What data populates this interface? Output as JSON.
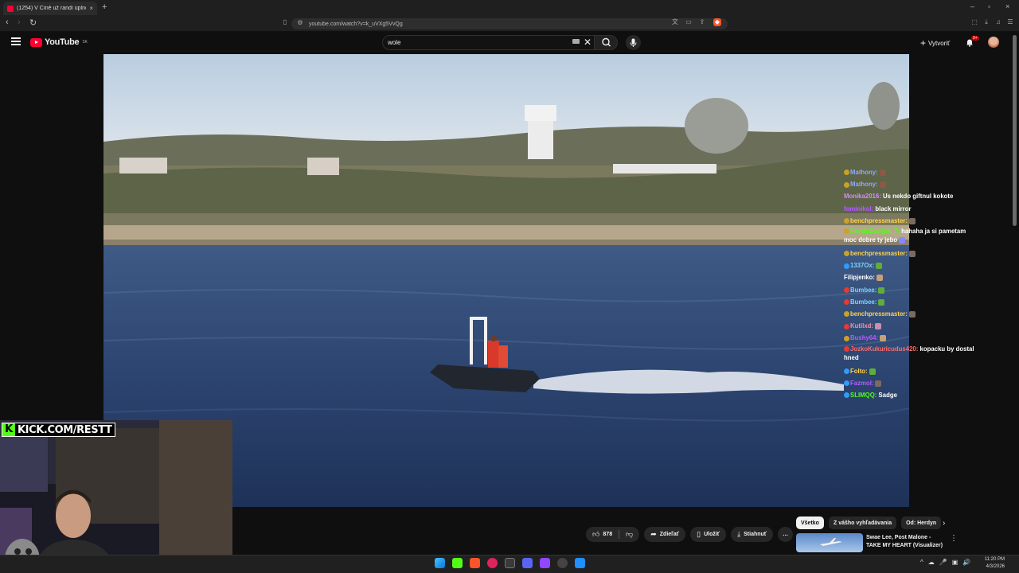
{
  "browser": {
    "tab_title": "(1254) V Číně už randí úplně…",
    "tab_close": "×",
    "new_tab": "+",
    "url": "youtube.com/watch?v=k_uVXg5VvQg",
    "window_controls": [
      "–",
      "▫",
      "×"
    ]
  },
  "masthead": {
    "logo_text": "YouTube",
    "region": "SK",
    "search_value": "wole",
    "clear_glyph": "✕",
    "create_label": "Vytvoriť",
    "notif_count": "9+"
  },
  "overlay": {
    "kick_brand": "KICK.COM/RESTT",
    "kick_letter": "K"
  },
  "chat": {
    "lines": [
      {
        "user": "Mathony:",
        "msg": "",
        "user_color": "#8fa9ff",
        "badge": "#c9a227",
        "emote": "#8a5a44"
      },
      {
        "user": "Mathony:",
        "msg": "",
        "user_color": "#8fa9ff",
        "badge": "#c9a227",
        "emote": "#8a5a44"
      },
      {
        "user": "Monika2016:",
        "msg": "Us nekdo giftnul kokote",
        "user_color": "#d68cf5",
        "badge": "",
        "emote": ""
      },
      {
        "user": "fominikol:",
        "msg": "black mirror",
        "user_color": "#b65cff",
        "badge": "",
        "emote": ""
      },
      {
        "user": "benchpressmaster:",
        "msg": "",
        "user_color": "#ffd24d",
        "badge": "#c9a227",
        "emote": "#7a6a60"
      },
      {
        "user": "DandaZabijak_7:",
        "msg": "hahaha ja si pametam moc dobre ty jebo",
        "user_color": "#53fc18",
        "badge": "#c9a227",
        "emote": "#8888ff",
        "wrap": true
      },
      {
        "user": "benchpressmaster:",
        "msg": "",
        "user_color": "#ffd24d",
        "badge": "#c9a227",
        "emote": "#7a6a60"
      },
      {
        "user": "1337Ox:",
        "msg": "",
        "user_color": "#7fd3ff",
        "badge": "#2d9cff",
        "emote": "#5fae3a"
      },
      {
        "user": "Filipjenko:",
        "msg": "",
        "user_color": "#ffffff",
        "badge": "",
        "emote": "#c8a07a"
      },
      {
        "user": "Bumbee:",
        "msg": "",
        "user_color": "#7fd3ff",
        "badge": "#e53935",
        "emote": "#5fae3a"
      },
      {
        "user": "Bumbee:",
        "msg": "",
        "user_color": "#7fd3ff",
        "badge": "#e53935",
        "emote": "#5fae3a"
      },
      {
        "user": "benchpressmaster:",
        "msg": "",
        "user_color": "#ffd24d",
        "badge": "#c9a227",
        "emote": "#7a6a60"
      },
      {
        "user": "Kutilxd:",
        "msg": "",
        "user_color": "#ff8fa3",
        "badge": "#e53935",
        "emote": "#c98fb0"
      },
      {
        "user": "Bushy64:",
        "msg": "",
        "user_color": "#b65cff",
        "badge": "#c9a227",
        "emote": "#c8a07a"
      },
      {
        "user": "JozkoKukuricudus420:",
        "msg": "kopacku by dostal hned",
        "user_color": "#ff6b6b",
        "badge": "#e53935",
        "emote": "",
        "wrap": true
      },
      {
        "user": "Folto:",
        "msg": "",
        "user_color": "#ffd24d",
        "badge": "#2d9cff",
        "emote": "#5fae3a"
      },
      {
        "user": "Fazmol:",
        "msg": "",
        "user_color": "#b65cff",
        "badge": "#2d9cff",
        "emote": "#7a6a60"
      },
      {
        "user": "SLIMQQ:",
        "msg": "Sadge",
        "user_color": "#53fc18",
        "badge": "#2d9cff",
        "emote": ""
      }
    ]
  },
  "actions": {
    "likes": "878",
    "share": "Zdieľať",
    "save": "Uložiť",
    "download": "Stiahnuť",
    "more": "…"
  },
  "recommendations": {
    "chips": [
      "Všetko",
      "Z vášho vyhľadávania",
      "Od: Herdyn"
    ],
    "next_glyph": "›",
    "first_title": "Swae Lee, Post Malone - TAKE MY HEART (Visualizer)",
    "menu_glyph": "⋮"
  },
  "taskbar": {
    "time": "11:20 PM",
    "date": "4/3/2026",
    "tray": [
      "^",
      "☁",
      "🎤",
      "▣",
      "🔊"
    ]
  },
  "colors": {
    "accent": "#ff0033",
    "kick_green": "#53fc18"
  }
}
